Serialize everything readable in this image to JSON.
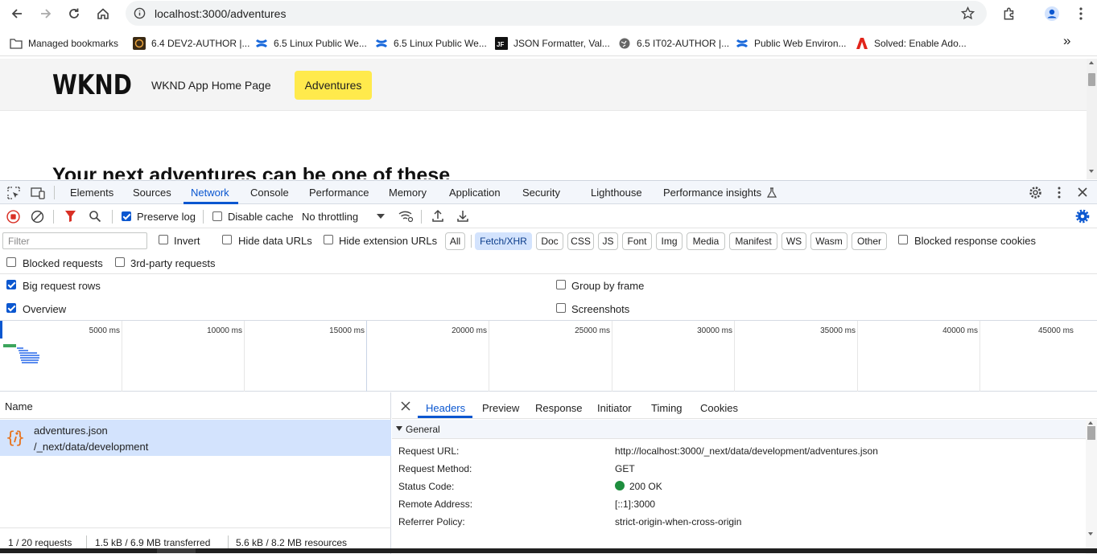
{
  "browser": {
    "url": "localhost:3000/adventures",
    "bookmarks": [
      {
        "label": "Managed bookmarks",
        "icon": "folder-icon"
      },
      {
        "label": "6.4 DEV2-AUTHOR |...",
        "icon": "aem-icon"
      },
      {
        "label": "6.5 Linux Public We...",
        "icon": "confluence-icon"
      },
      {
        "label": "6.5 Linux Public We...",
        "icon": "confluence-icon"
      },
      {
        "label": "JSON Formatter, Val...",
        "icon": "jf-icon"
      },
      {
        "label": "6.5 IT02-AUTHOR |...",
        "icon": "globe-icon"
      },
      {
        "label": "Public Web Environ...",
        "icon": "confluence-icon"
      },
      {
        "label": "Solved: Enable Ado...",
        "icon": "adobe-icon"
      }
    ],
    "more_bookmarks": "»"
  },
  "page": {
    "logo": "WKND",
    "home_link": "WKND App Home Page",
    "adventures_button": "Adventures",
    "headline": "Your next adventures can be one of these"
  },
  "devtools": {
    "tabs": [
      "Elements",
      "Sources",
      "Network",
      "Console",
      "Performance",
      "Memory",
      "Application",
      "Security",
      "Lighthouse",
      "Performance insights"
    ],
    "active_tab": "Network",
    "toolbar": {
      "preserve_log": "Preserve log",
      "preserve_log_checked": true,
      "disable_cache": "Disable cache",
      "disable_cache_checked": false,
      "throttling": "No throttling"
    },
    "filter": {
      "placeholder": "Filter",
      "invert": "Invert",
      "hide_data_urls": "Hide data URLs",
      "hide_extension_urls": "Hide extension URLs",
      "types": [
        "All",
        "Fetch/XHR",
        "Doc",
        "CSS",
        "JS",
        "Font",
        "Img",
        "Media",
        "Manifest",
        "WS",
        "Wasm",
        "Other"
      ],
      "active_type": "Fetch/XHR",
      "blocked_response_cookies": "Blocked response cookies",
      "blocked_requests": "Blocked requests",
      "third_party_requests": "3rd-party requests"
    },
    "settings": {
      "big_request_rows": "Big request rows",
      "big_request_rows_checked": true,
      "group_by_frame": "Group by frame",
      "group_by_frame_checked": false,
      "overview": "Overview",
      "overview_checked": true,
      "screenshots": "Screenshots",
      "screenshots_checked": false
    },
    "overview_ticks": [
      "5000 ms",
      "10000 ms",
      "15000 ms",
      "20000 ms",
      "25000 ms",
      "30000 ms",
      "35000 ms",
      "40000 ms",
      "45000 ms"
    ],
    "request_list": {
      "column": "Name",
      "rows": [
        {
          "name": "adventures.json",
          "path": "/_next/data/development",
          "icon": "json-icon"
        }
      ],
      "status": {
        "requests": "1 / 20 requests",
        "transferred": "1.5 kB / 6.9 MB transferred",
        "resources": "5.6 kB / 8.2 MB resources"
      }
    },
    "details": {
      "tabs": [
        "Headers",
        "Preview",
        "Response",
        "Initiator",
        "Timing",
        "Cookies"
      ],
      "active_tab": "Headers",
      "section": "General",
      "rows": [
        {
          "key": "Request URL:",
          "value": "http://localhost:3000/_next/data/development/adventures.json"
        },
        {
          "key": "Request Method:",
          "value": "GET"
        },
        {
          "key": "Status Code:",
          "value": "200 OK"
        },
        {
          "key": "Remote Address:",
          "value": "[::1]:3000"
        },
        {
          "key": "Referrer Policy:",
          "value": "strict-origin-when-cross-origin"
        }
      ],
      "status_color": "#1e8e3e"
    }
  },
  "colors": {
    "accent": "#0b57d0",
    "adventures_button": "#ffea4c",
    "selected_row": "#d3e3fd"
  }
}
